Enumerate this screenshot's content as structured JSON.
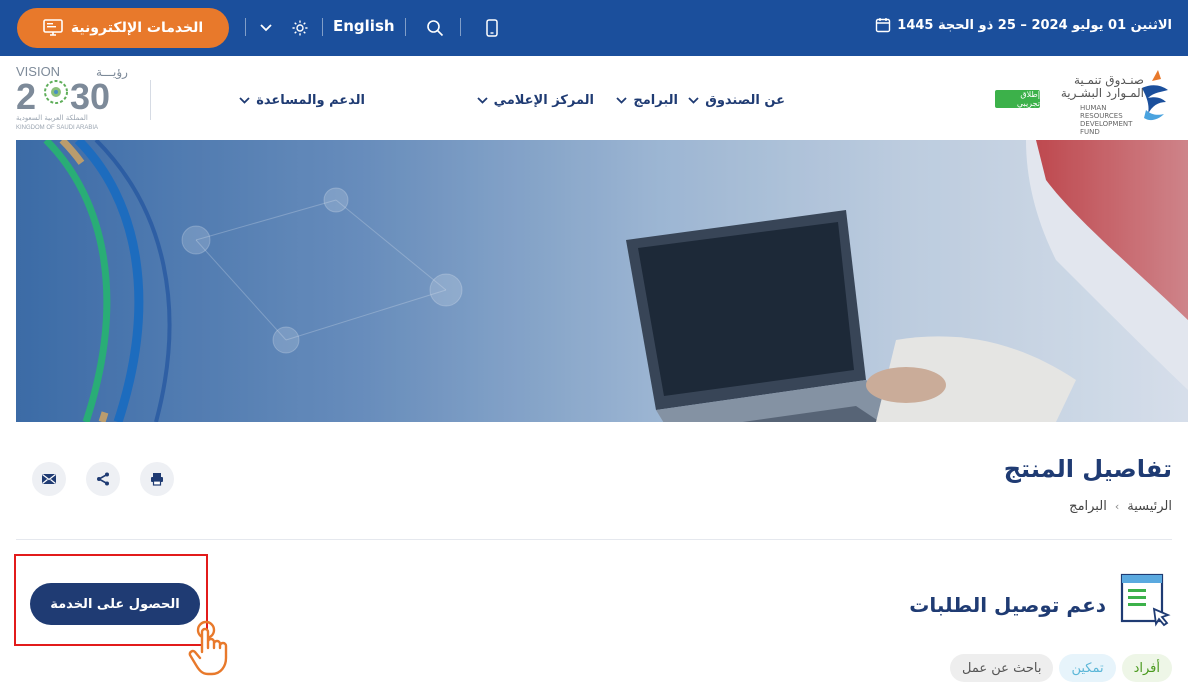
{
  "topbar": {
    "eservices_label": "الخدمات الإلكترونية",
    "language_label": "English",
    "date_text": "الاثنين 01 يوليو 2024  –  25 ذو الحجة 1445"
  },
  "header": {
    "vision": {
      "top": "VISION",
      "arabic_top": "رؤيـــة",
      "year_left": "2",
      "year_right": "30",
      "kingdom_ar": "المملكة العربية السعودية",
      "kingdom_en": "KINGDOM OF SAUDI ARABIA"
    },
    "nav": [
      {
        "label": "عن الصندوق"
      },
      {
        "label": "البرامج"
      },
      {
        "label": "المركز الإعلامي"
      },
      {
        "label": "الدعم والمساعدة"
      }
    ],
    "logo": {
      "name_ar_1": "صنـدوق تنمـية",
      "name_ar_2": "المـوارد البشـرية",
      "name_en": "HUMAN RESOURCES DEVELOPMENT FUND",
      "beta_label": "إطلاق تجريبي"
    }
  },
  "page": {
    "title": "تفاصيل المنتج",
    "breadcrumb": [
      "الرئيسية",
      "البرامج"
    ],
    "breadcrumb_sep": "›"
  },
  "service": {
    "title": "دعم توصيل الطلبات",
    "cta_label": "الحصول على الخدمة",
    "tags": [
      "أفراد",
      "تمكين",
      "باحث عن عمل"
    ]
  },
  "colors": {
    "primary": "#1b4f9c",
    "navy": "#1f3b73",
    "accent_orange": "#e8792b",
    "highlight_red": "#e21b1b",
    "green_beta": "#3cb14a"
  }
}
